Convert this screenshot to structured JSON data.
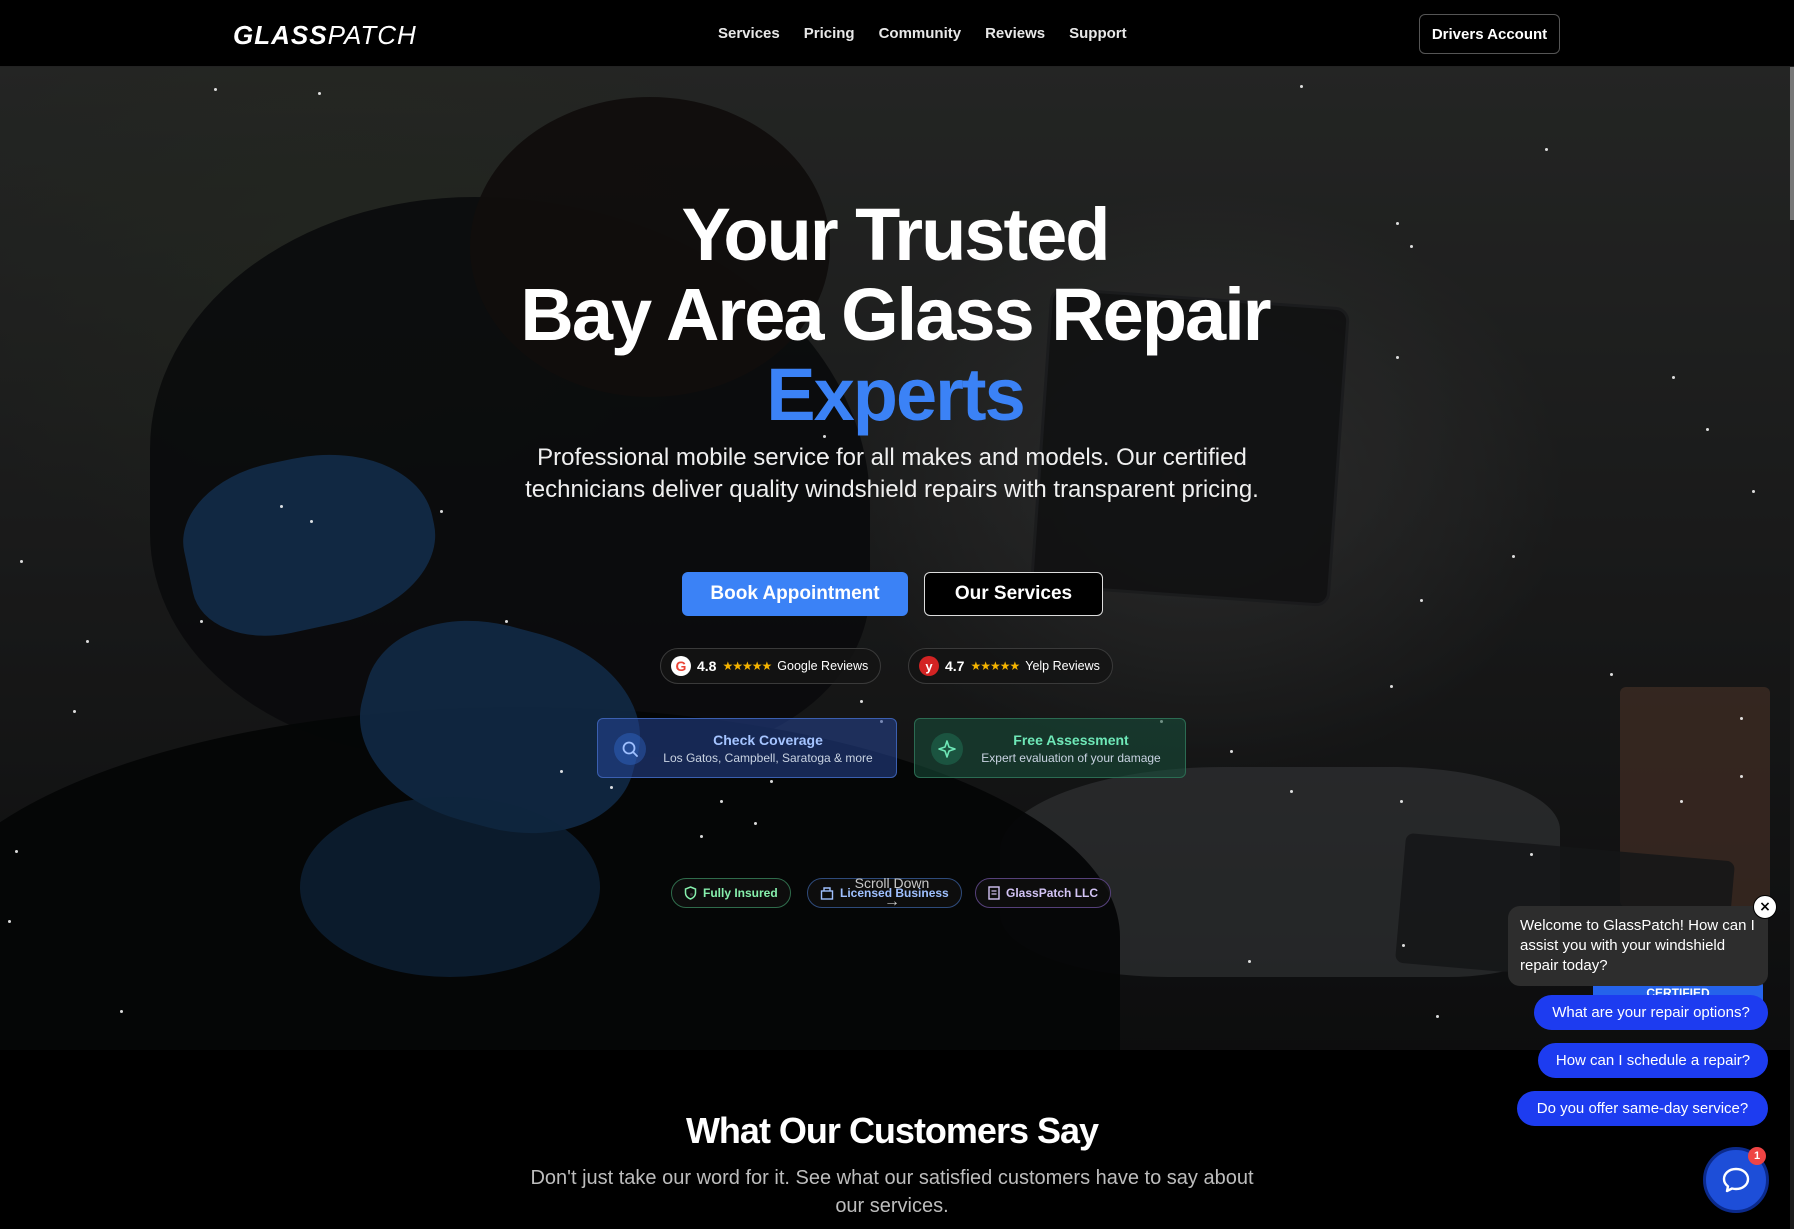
{
  "nav": {
    "logo_bold": "GLASS",
    "logo_light": "PATCH",
    "links": [
      "Services",
      "Pricing",
      "Community",
      "Reviews",
      "Support"
    ],
    "account_button": "Drivers Account"
  },
  "hero": {
    "headline_line1": "Your Trusted",
    "headline_line2": "Bay Area Glass Repair",
    "headline_line3": "Experts",
    "subtitle": "Professional mobile service for all makes and models. Our certified technicians deliver quality windshield repairs with transparent pricing.",
    "book_button": "Book Appointment",
    "services_button": "Our Services",
    "reviews": [
      {
        "icon": "google-icon",
        "icon_text": "G",
        "score": "4.8",
        "stars": "★★★★★",
        "label": "Google Reviews"
      },
      {
        "icon": "yelp-icon",
        "icon_text": "y",
        "score": "4.7",
        "stars": "★★★★★",
        "label": "Yelp Reviews"
      }
    ],
    "coverage_card": {
      "title": "Check Coverage",
      "subtitle": "Los Gatos, Campbell, Saratoga & more",
      "icon": "search-icon"
    },
    "assessment_card": {
      "title": "Free Assessment",
      "subtitle": "Expert evaluation of your damage",
      "icon": "sparkle-icon"
    },
    "badges": [
      {
        "icon": "shield-icon",
        "label": "Fully Insured"
      },
      {
        "icon": "building-icon",
        "label": "Licensed Business"
      },
      {
        "icon": "document-icon",
        "label": "GlassPatch LLC"
      }
    ],
    "scroll_label": "Scroll Down",
    "scroll_icon": "arrow-right-icon"
  },
  "testimonials": {
    "title": "What Our Customers Say",
    "subtitle": "Don't just take our word for it. See what our satisfied customers have to say about our services."
  },
  "chat": {
    "welcome": "Welcome to GlassPatch! How can I assist you with your windshield repair today?",
    "close_icon": "close-icon",
    "peek_label": "CERTIFIED",
    "quick_replies": [
      "What are your repair options?",
      "How can I schedule a repair?",
      "Do you offer same-day service?"
    ],
    "launcher_icon": "chat-bubble-icon",
    "unread_count": "1"
  },
  "colors": {
    "accent": "#3b82f6",
    "quick_reply": "#1d3cf0",
    "star": "#f5b400",
    "insured": "#86efac",
    "licensed": "#9fc0ff",
    "llc": "#d3c4f5"
  }
}
